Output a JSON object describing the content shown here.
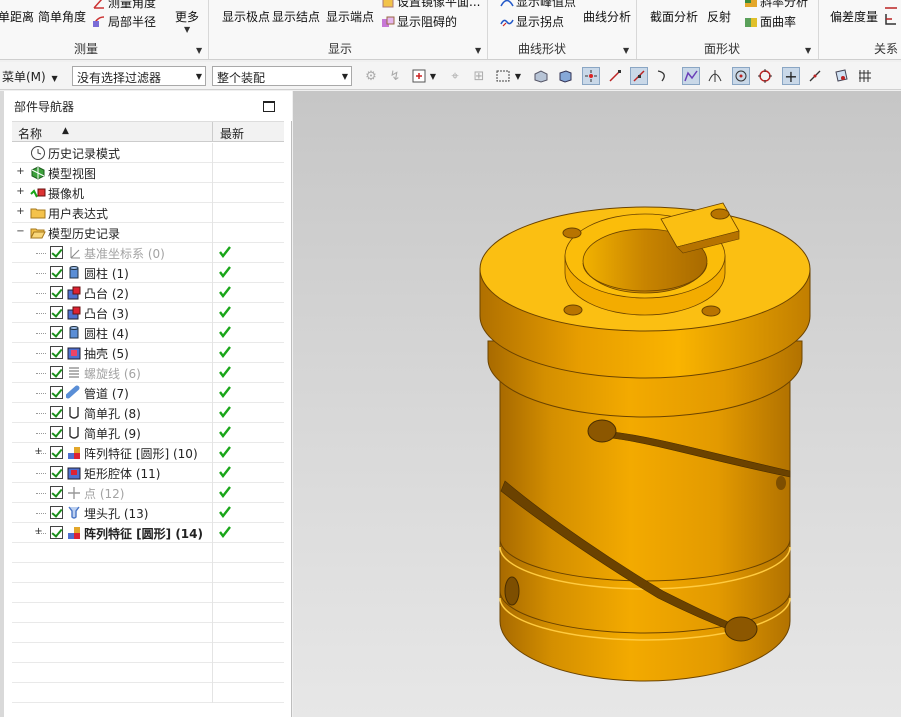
{
  "ribbon": {
    "measure": {
      "group_label": "测量",
      "items": [
        "单距离",
        "简单角度",
        "测量角度",
        "局部半径",
        "更多"
      ]
    },
    "display": {
      "group_label": "显示",
      "items": [
        "显示极点",
        "显示结点",
        "显示端点",
        "设置镜像平面...",
        "显示阻碍的"
      ]
    },
    "curve_shape": {
      "group_label": "曲线形状",
      "items": [
        "显示峰值点",
        "显示拐点",
        "曲线分析"
      ]
    },
    "face_shape": {
      "group_label": "面形状",
      "items": [
        "截面分析",
        "反射",
        "斜率分析",
        "面曲率"
      ]
    },
    "relation": {
      "group_label": "关系",
      "items": [
        "偏差度量"
      ]
    }
  },
  "toolbar": {
    "menu_label": "菜单(M)",
    "filter_value": "没有选择过滤器",
    "assembly_value": "整个装配"
  },
  "navigator": {
    "title": "部件导航器",
    "col_name": "名称",
    "col_latest": "最新",
    "rows": [
      {
        "label": "历史记录模式",
        "icon": "clock-icon"
      },
      {
        "label": "模型视图",
        "icon": "views-icon"
      },
      {
        "label": "摄像机",
        "icon": "camera-icon"
      },
      {
        "label": "用户表达式",
        "icon": "folder-icon"
      },
      {
        "label": "模型历史记录",
        "icon": "folder-open-icon"
      },
      {
        "label": "基准坐标系 (0)",
        "icon": "csys-icon",
        "latest": true
      },
      {
        "label": "圆柱 (1)",
        "icon": "cylinder-icon",
        "latest": true
      },
      {
        "label": "凸台 (2)",
        "icon": "boss-icon",
        "latest": true
      },
      {
        "label": "凸台 (3)",
        "icon": "boss-icon",
        "latest": true
      },
      {
        "label": "圆柱 (4)",
        "icon": "cylinder-icon",
        "latest": true
      },
      {
        "label": "抽壳 (5)",
        "icon": "shell-icon",
        "latest": true
      },
      {
        "label": "螺旋线 (6)",
        "icon": "helix-icon",
        "latest": true
      },
      {
        "label": "管道 (7)",
        "icon": "tube-icon",
        "latest": true
      },
      {
        "label": "简单孔 (8)",
        "icon": "hole-icon",
        "latest": true
      },
      {
        "label": "简单孔 (9)",
        "icon": "hole-icon",
        "latest": true
      },
      {
        "label": "阵列特征 [圆形] (10)",
        "icon": "pattern-icon",
        "latest": true
      },
      {
        "label": "矩形腔体 (11)",
        "icon": "pocket-icon",
        "latest": true
      },
      {
        "label": "点 (12)",
        "icon": "point-icon",
        "latest": true
      },
      {
        "label": "埋头孔 (13)",
        "icon": "countersink-icon",
        "latest": true
      },
      {
        "label": "阵列特征 [圆形] (14)",
        "icon": "pattern-icon",
        "latest": true
      }
    ]
  },
  "colors": {
    "part_light": "#fbbd0a",
    "part_mid": "#e8a000",
    "part_dark": "#b87400",
    "check_green": "#19a619"
  }
}
